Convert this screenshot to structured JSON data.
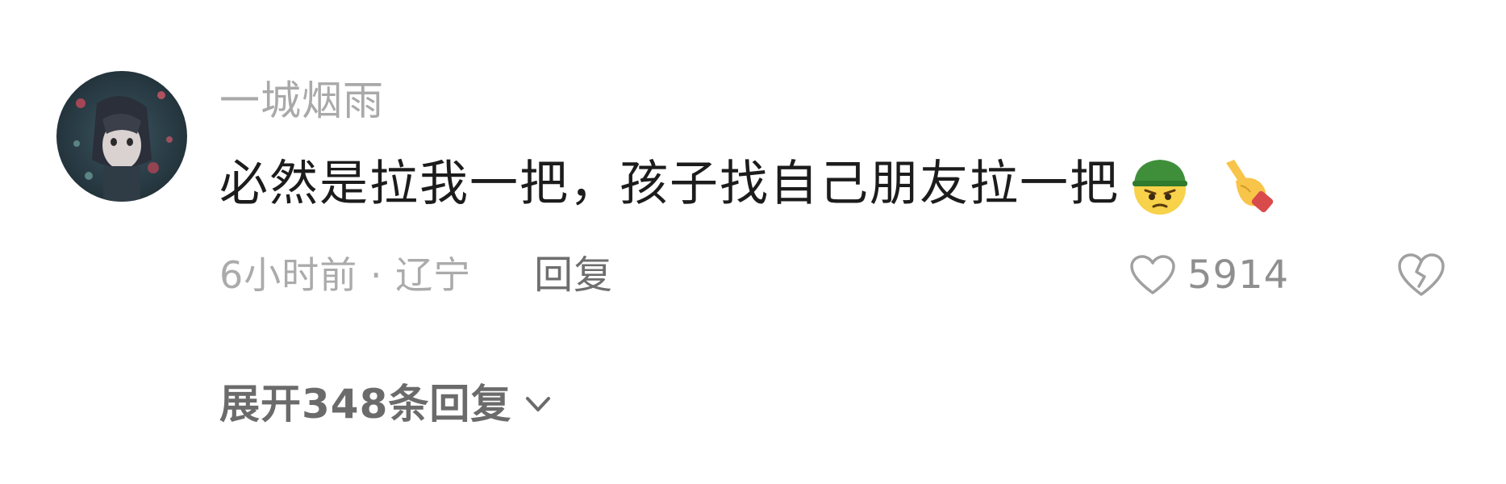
{
  "comment": {
    "username": "一城烟雨",
    "text": "必然是拉我一把，孩子找自己朋友拉一把",
    "emojis": [
      "angry-face-green-helmet-emoji",
      "pointing-hand-emoji"
    ],
    "meta": "6小时前 · 辽宁",
    "reply_label": "回复",
    "like_count": "5914",
    "expand_replies_label": "展开348条回复"
  },
  "icons": {
    "like": "heart-outline-icon",
    "dislike": "broken-heart-outline-icon",
    "expand": "chevron-down-icon"
  },
  "colors": {
    "username": "#a9a9a9",
    "comment_text": "#1c1c1c",
    "meta": "#ababab",
    "reply": "#6e6e6e",
    "like_count": "#8f8f8f",
    "expand": "#6b6b6b"
  }
}
